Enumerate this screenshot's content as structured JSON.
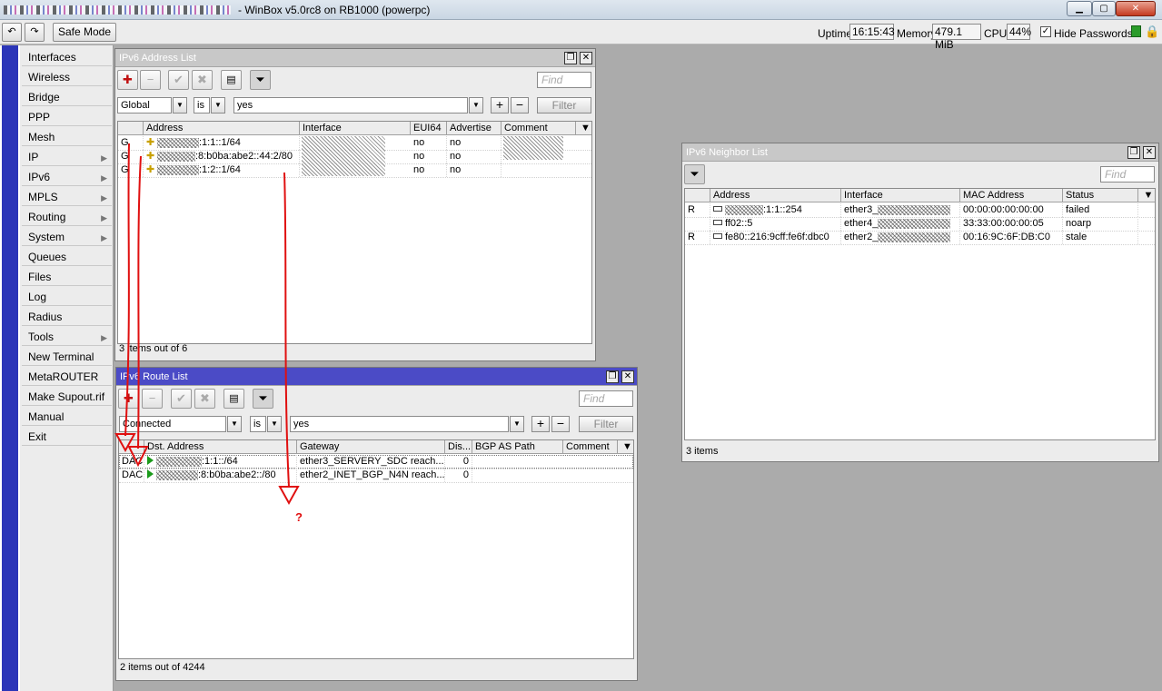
{
  "app": {
    "title": "- WinBox v5.0rc8 on RB1000 (powerpc)",
    "min_label": "▁",
    "max_label": "▢",
    "close_label": "✕"
  },
  "toolbar": {
    "undo": "↶",
    "redo": "↷",
    "safe_mode": "Safe Mode",
    "uptime_label": "Uptime:",
    "uptime_value": "16:15:43",
    "memory_label": "Memory:",
    "memory_value": "479.1 MiB",
    "cpu_label": "CPU:",
    "cpu_value": "44%",
    "hide_passwords": "Hide Passwords",
    "hide_passwords_checked": "✓"
  },
  "menu": [
    {
      "label": "Interfaces",
      "sub": ""
    },
    {
      "label": "Wireless",
      "sub": ""
    },
    {
      "label": "Bridge",
      "sub": ""
    },
    {
      "label": "PPP",
      "sub": ""
    },
    {
      "label": "Mesh",
      "sub": ""
    },
    {
      "label": "IP",
      "sub": "▶"
    },
    {
      "label": "IPv6",
      "sub": "▶"
    },
    {
      "label": "MPLS",
      "sub": "▶"
    },
    {
      "label": "Routing",
      "sub": "▶"
    },
    {
      "label": "System",
      "sub": "▶"
    },
    {
      "label": "Queues",
      "sub": ""
    },
    {
      "label": "Files",
      "sub": ""
    },
    {
      "label": "Log",
      "sub": ""
    },
    {
      "label": "Radius",
      "sub": ""
    },
    {
      "label": "Tools",
      "sub": "▶"
    },
    {
      "label": "New Terminal",
      "sub": ""
    },
    {
      "label": "MetaROUTER",
      "sub": ""
    },
    {
      "label": "Make Supout.rif",
      "sub": ""
    },
    {
      "label": "Manual",
      "sub": ""
    },
    {
      "label": "Exit",
      "sub": ""
    }
  ],
  "addr_win": {
    "title": "IPv6 Address List",
    "find": "Find",
    "filter_field": "Global",
    "filter_op": "is",
    "filter_value": "yes",
    "filter_btn": "Filter",
    "columns": [
      "",
      "Address",
      "Interface",
      "EUI64",
      "Advertise",
      "Comment"
    ],
    "rows": [
      {
        "flag": "G",
        "address": ":1:1::1/64",
        "eui64": "no",
        "advertise": "no"
      },
      {
        "flag": "G",
        "address": ":8:b0ba:abe2::44:2/80",
        "eui64": "no",
        "advertise": "no"
      },
      {
        "flag": "G",
        "address": ":1:2::1/64",
        "eui64": "no",
        "advertise": "no"
      }
    ],
    "status": "3 items out of 6"
  },
  "route_win": {
    "title": "IPv6 Route List",
    "find": "Find",
    "filter_field": "Connected",
    "filter_op": "is",
    "filter_value": "yes",
    "filter_btn": "Filter",
    "columns": [
      "",
      "Dst. Address",
      "Gateway",
      "Dis...",
      "BGP AS Path",
      "Comment"
    ],
    "rows": [
      {
        "flag": "DAC",
        "dst": ":1:1::/64",
        "gateway": "ether3_SERVERY_SDC reach...",
        "dist": "0"
      },
      {
        "flag": "DAC",
        "dst": ":8:b0ba:abe2::/80",
        "gateway": "ether2_INET_BGP_N4N reach...",
        "dist": "0"
      }
    ],
    "status": "2 items out of 4244"
  },
  "nb_win": {
    "title": "IPv6 Neighbor List",
    "find": "Find",
    "columns": [
      "",
      "Address",
      "Interface",
      "MAC Address",
      "Status"
    ],
    "rows": [
      {
        "flag": "R",
        "address": ":1:1::254",
        "interface": "ether3_",
        "mac": "00:00:00:00:00:00",
        "status": "failed"
      },
      {
        "flag": "",
        "address": "ff02::5",
        "interface": "ether4_",
        "mac": "33:33:00:00:00:05",
        "status": "noarp"
      },
      {
        "flag": "R",
        "address": "fe80::216:9cff:fe6f:dbc0",
        "interface": "ether2_",
        "mac": "00:16:9C:6F:DB:C0",
        "status": "stale"
      }
    ],
    "status": "3 items"
  },
  "annotation": {
    "question": "?",
    "color": "#e01010"
  }
}
